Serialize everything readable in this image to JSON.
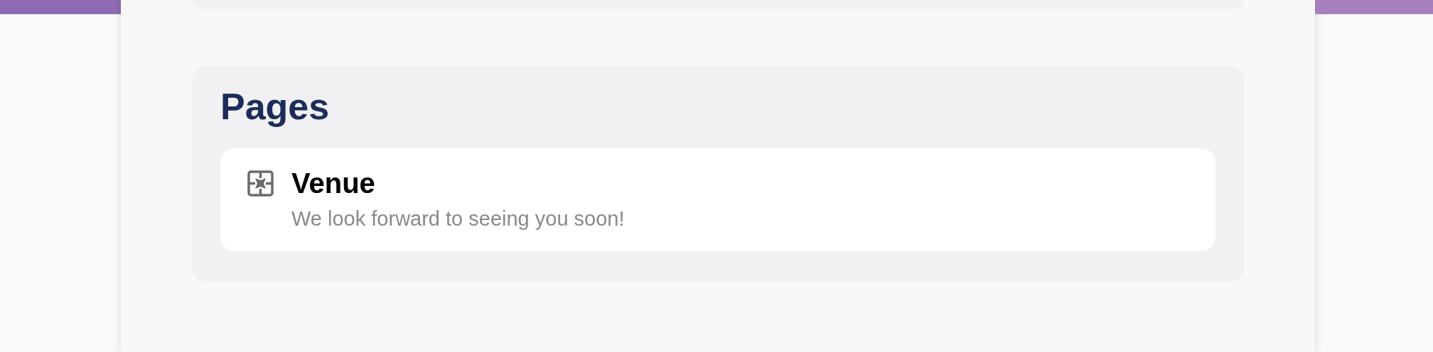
{
  "section": {
    "title": "Pages",
    "pages": [
      {
        "title": "Venue",
        "description": "We look forward to seeing you soon!"
      }
    ]
  }
}
